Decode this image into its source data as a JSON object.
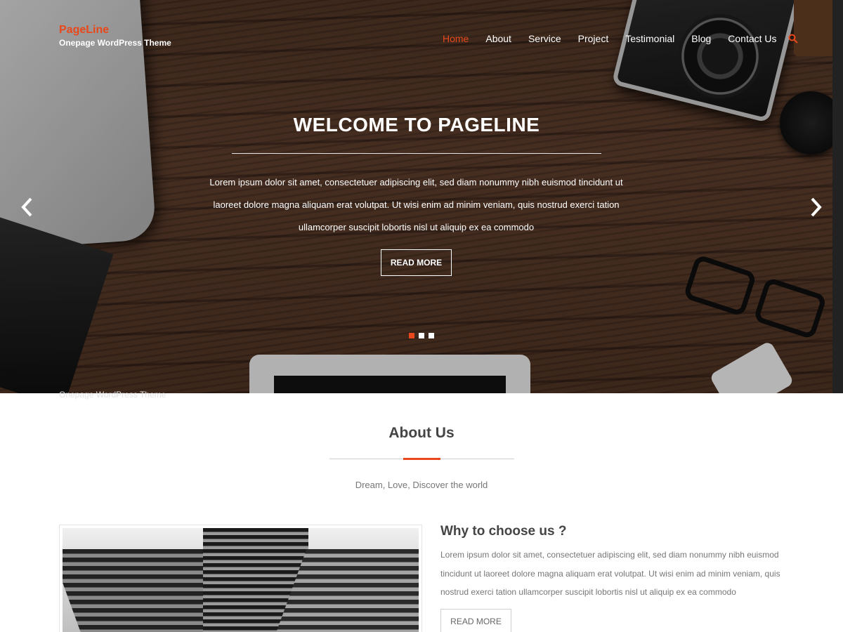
{
  "brand": {
    "title": "PageLine",
    "tagline": "Onepage WordPress Theme"
  },
  "nav": {
    "items": [
      {
        "label": "Home",
        "active": true
      },
      {
        "label": "About"
      },
      {
        "label": "Service"
      },
      {
        "label": "Project"
      },
      {
        "label": "Testimonial"
      },
      {
        "label": "Blog"
      },
      {
        "label": "Contact Us"
      }
    ],
    "search_icon": "search-icon"
  },
  "slider": {
    "title": "WELCOME TO PAGELINE",
    "text": "Lorem ipsum dolor sit amet, consectetuer adipiscing elit, sed diam nonummy nibh euismod tincidunt ut laoreet dolore magna aliquam erat volutpat. Ut wisi enim ad minim veniam, quis nostrud exerci tation ullamcorper suscipit lobortis nisl ut aliquip ex ea commodo",
    "button_label": "READ MORE",
    "prev_icon": "chevron-left-icon",
    "next_icon": "chevron-right-icon",
    "slide_count": 3,
    "active_slide": 1
  },
  "about": {
    "ghost_tagline": "Onepage WordPress Theme",
    "title": "About Us",
    "subtitle": "Dream, Love, Discover the world",
    "why_title": "Why to choose us ?",
    "why_text": "Lorem ipsum dolor sit amet, consectetuer adipiscing elit, sed diam nonummy nibh euismod tincidunt ut laoreet dolore magna aliquam erat volutpat. Ut wisi enim ad minim veniam, quis nostrud exerci tation ullamcorper suscipit lobortis nisl ut aliquip ex ea commodo",
    "button_label": "READ MORE"
  },
  "colors": {
    "accent": "#e8481c",
    "text": "#444444",
    "muted": "#777777"
  }
}
